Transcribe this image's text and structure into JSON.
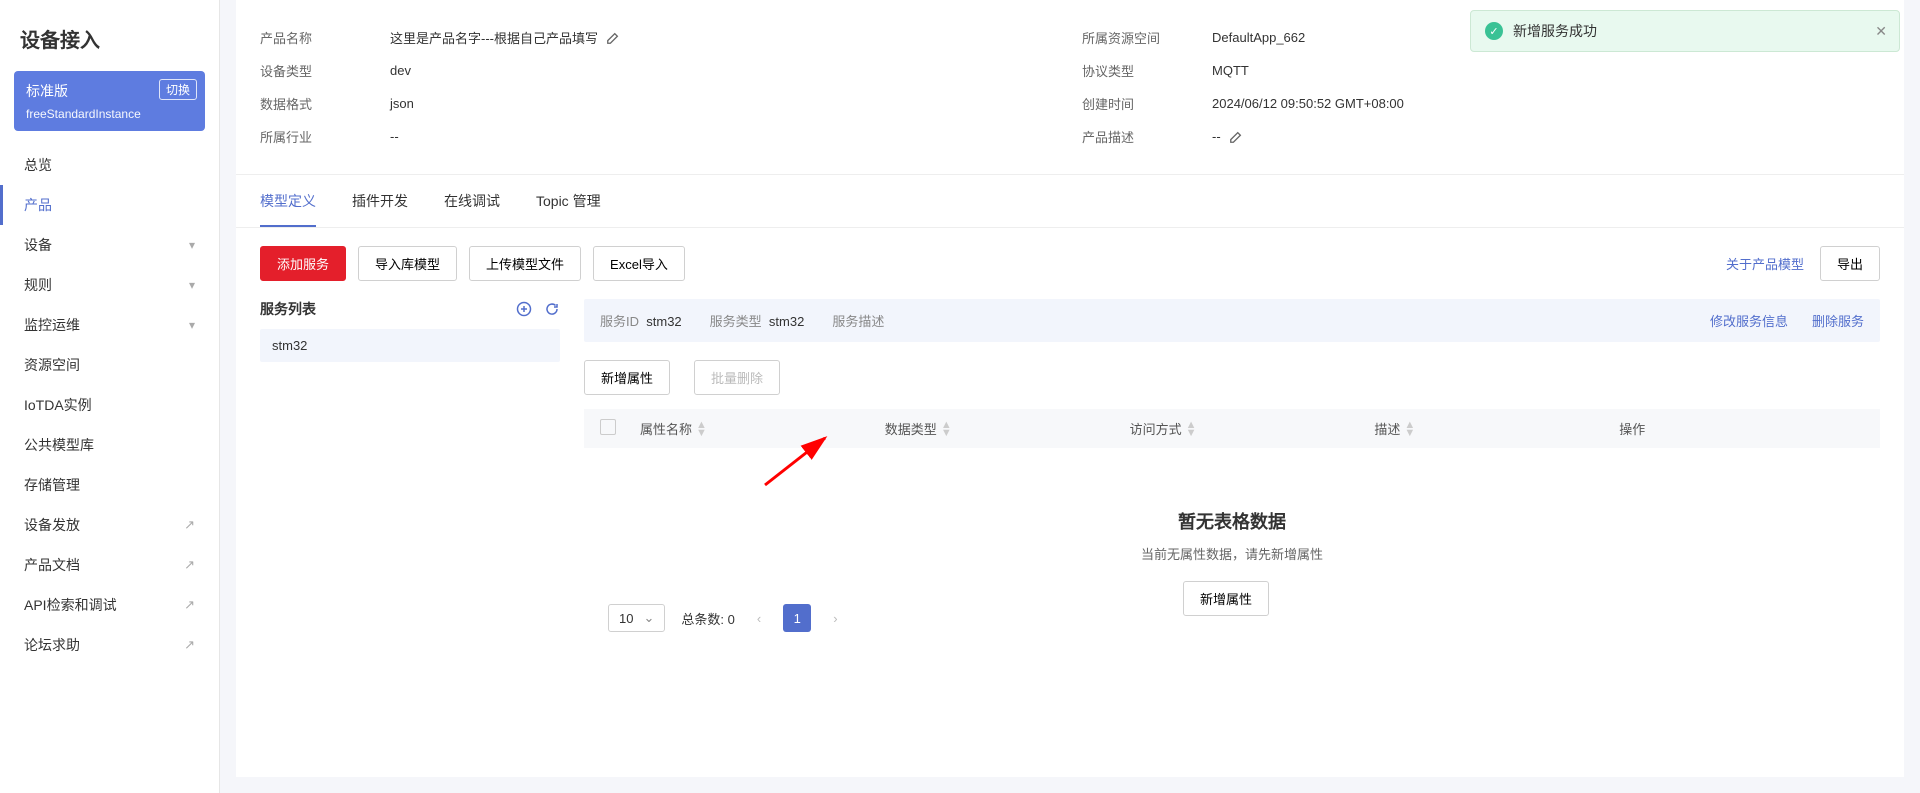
{
  "sidebar": {
    "title": "设备接入",
    "instance": {
      "title": "标准版",
      "switch": "切换",
      "name": "freeStandardInstance"
    },
    "nav": [
      {
        "label": "总览"
      },
      {
        "label": "产品",
        "active": true
      },
      {
        "label": "设备",
        "expand": true
      },
      {
        "label": "规则",
        "expand": true
      },
      {
        "label": "监控运维",
        "expand": true
      },
      {
        "label": "资源空间"
      },
      {
        "label": "IoTDA实例"
      },
      {
        "label": "公共模型库"
      },
      {
        "label": "存储管理"
      },
      {
        "label": "设备发放",
        "ext": true
      },
      {
        "label": "产品文档",
        "ext": true
      },
      {
        "label": "API检索和调试",
        "ext": true
      },
      {
        "label": "论坛求助",
        "ext": true
      }
    ]
  },
  "toast": {
    "text": "新增服务成功"
  },
  "info": {
    "product_name_label": "产品名称",
    "product_name": "这里是产品名字---根据自己产品填写",
    "resource_space_label": "所属资源空间",
    "resource_space": "DefaultApp_662",
    "device_type_label": "设备类型",
    "device_type": "dev",
    "protocol_label": "协议类型",
    "protocol": "MQTT",
    "data_format_label": "数据格式",
    "data_format": "json",
    "create_time_label": "创建时间",
    "create_time": "2024/06/12 09:50:52 GMT+08:00",
    "industry_label": "所属行业",
    "industry": "--",
    "desc_label": "产品描述",
    "desc": "--"
  },
  "tabs": [
    "模型定义",
    "插件开发",
    "在线调试",
    "Topic 管理"
  ],
  "toolbar": {
    "add_service": "添加服务",
    "import_lib": "导入库模型",
    "upload_model": "上传模型文件",
    "excel_import": "Excel导入",
    "about_model": "关于产品模型",
    "export": "导出"
  },
  "service": {
    "list_title": "服务列表",
    "items": [
      "stm32"
    ],
    "id_label": "服务ID",
    "id": "stm32",
    "type_label": "服务类型",
    "type": "stm32",
    "desc_label": "服务描述",
    "edit": "修改服务信息",
    "delete": "删除服务"
  },
  "attrs": {
    "add": "新增属性",
    "batch_delete": "批量删除",
    "cols": [
      "属性名称",
      "数据类型",
      "访问方式",
      "描述",
      "操作"
    ],
    "empty_title": "暂无表格数据",
    "empty_sub": "当前无属性数据，请先新增属性",
    "empty_btn": "新增属性"
  },
  "pager": {
    "size": "10",
    "total_label": "总条数:",
    "total": "0",
    "page": "1"
  }
}
